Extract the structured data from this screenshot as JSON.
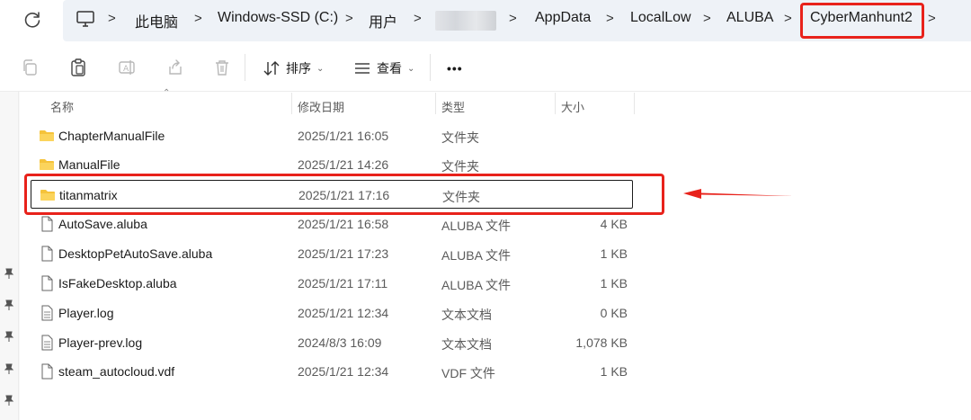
{
  "address_bar": {
    "crumbs": [
      "此电脑",
      "Windows-SSD (C:)",
      "用户",
      "AppData",
      "LocalLow",
      "ALUBA",
      "CyberManhunt2"
    ]
  },
  "toolbar": {
    "sort_label": "排序",
    "view_label": "查看",
    "more_label": "•••"
  },
  "columns": {
    "name": "名称",
    "date": "修改日期",
    "type": "类型",
    "size": "大小"
  },
  "files": [
    {
      "name": "ChapterManualFile",
      "date": "2025/1/21 16:05",
      "type": "文件夹",
      "size": "",
      "icon": "folder-icon"
    },
    {
      "name": "ManualFile",
      "date": "2025/1/21 14:26",
      "type": "文件夹",
      "size": "",
      "icon": "folder-icon"
    },
    {
      "name": "titanmatrix",
      "date": "2025/1/21 17:16",
      "type": "文件夹",
      "size": "",
      "icon": "folder-icon"
    },
    {
      "name": "AutoSave.aluba",
      "date": "2025/1/21 16:58",
      "type": "ALUBA 文件",
      "size": "4 KB",
      "icon": "file-icon"
    },
    {
      "name": "DesktopPetAutoSave.aluba",
      "date": "2025/1/21 17:23",
      "type": "ALUBA 文件",
      "size": "1 KB",
      "icon": "file-icon"
    },
    {
      "name": "IsFakeDesktop.aluba",
      "date": "2025/1/21 17:11",
      "type": "ALUBA 文件",
      "size": "1 KB",
      "icon": "file-icon"
    },
    {
      "name": "Player.log",
      "date": "2025/1/21 12:34",
      "type": "文本文档",
      "size": "0 KB",
      "icon": "text-file-icon"
    },
    {
      "name": "Player-prev.log",
      "date": "2024/8/3 16:09",
      "type": "文本文档",
      "size": "1,078 KB",
      "icon": "text-file-icon"
    },
    {
      "name": "steam_autocloud.vdf",
      "date": "2025/1/21 12:34",
      "type": "VDF 文件",
      "size": "1 KB",
      "icon": "file-icon"
    }
  ],
  "colors": {
    "annotation": "#e8221b",
    "folder": "#f5c33b",
    "address_bg": "#eef2f7"
  }
}
